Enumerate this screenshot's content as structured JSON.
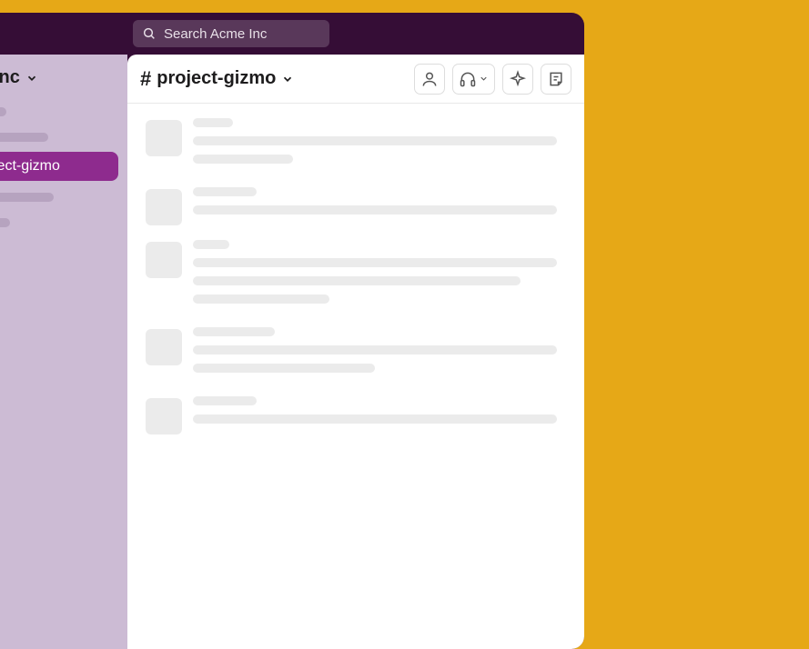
{
  "search": {
    "placeholder": "Search Acme Inc"
  },
  "workspace": {
    "name": "Inc"
  },
  "sidebar": {
    "selected_channel_label": "ject-gizmo"
  },
  "channel": {
    "icon": "#",
    "name": "project-gizmo"
  },
  "header_icons": {
    "person": "person-icon",
    "headphones": "headphones-icon",
    "sparkle": "sparkle-icon",
    "note": "note-icon"
  }
}
